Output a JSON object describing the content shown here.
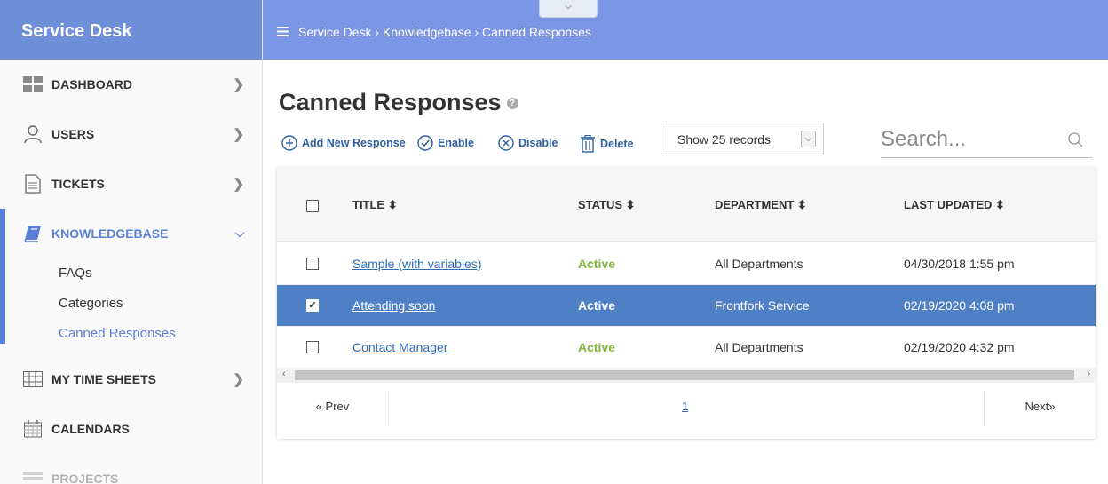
{
  "app": {
    "brand": "Service Desk"
  },
  "sidebar": {
    "items": [
      {
        "label": "DASHBOARD",
        "icon": "dashboard-icon"
      },
      {
        "label": "USERS",
        "icon": "user-icon"
      },
      {
        "label": "TICKETS",
        "icon": "document-icon"
      },
      {
        "label": "KNOWLEDGEBASE",
        "icon": "book-icon"
      },
      {
        "label": "MY TIME SHEETS",
        "icon": "table-grid-icon"
      },
      {
        "label": "CALENDARS",
        "icon": "calendar-icon"
      },
      {
        "label": "PROJECTS",
        "icon": "projects-icon"
      }
    ],
    "sub_items": [
      "FAQs",
      "Categories",
      "Canned Responses"
    ],
    "accent": "#5b7fd6"
  },
  "topbar": {
    "breadcrumb": "Service Desk  › Knowledgebase › Canned Responses"
  },
  "main": {
    "title": "Canned Responses",
    "toolbar": {
      "add": "Add New Response",
      "enable": "Enable",
      "disable": "Disable",
      "delete": "Delete"
    },
    "records_select": "Show 25 records",
    "search_placeholder": "Search..."
  },
  "table": {
    "columns": [
      "TITLE ⬍",
      "STATUS ⬍",
      "DEPARTMENT ⬍",
      "LAST UPDATED ⬍"
    ],
    "rows": [
      {
        "title": "Sample (with variables)",
        "status": "Active",
        "department": "All Departments",
        "updated": "04/30/2018 1:55 pm",
        "selected": false
      },
      {
        "title": "Attending soon",
        "status": "Active",
        "department": "Frontfork Service",
        "updated": "02/19/2020 4:08 pm",
        "selected": true
      },
      {
        "title": "Contact Manager",
        "status": "Active",
        "department": "All Departments",
        "updated": "02/19/2020 4:32 pm",
        "selected": false
      }
    ],
    "status_color": "#7fb93a",
    "selected_color": "#4f7fc5"
  },
  "pager": {
    "prev": "« Prev",
    "page": "1",
    "next": "Next»"
  }
}
